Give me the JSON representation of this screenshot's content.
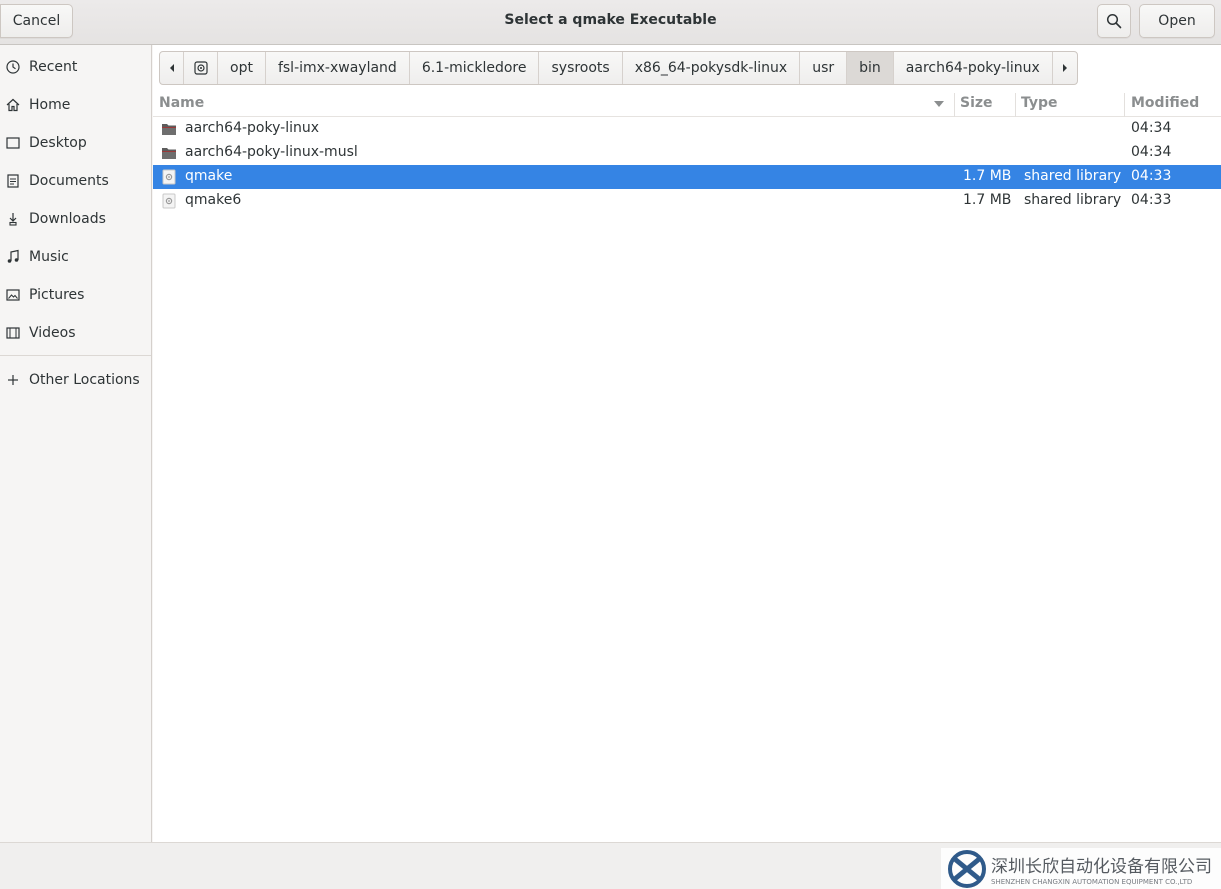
{
  "header": {
    "title": "Select a qmake Executable",
    "cancel_label": "Cancel",
    "open_label": "Open"
  },
  "sidebar": {
    "items": [
      {
        "label": "Recent",
        "icon": "clock-icon"
      },
      {
        "label": "Home",
        "icon": "home-icon"
      },
      {
        "label": "Desktop",
        "icon": "desktop-icon"
      },
      {
        "label": "Documents",
        "icon": "document-icon"
      },
      {
        "label": "Downloads",
        "icon": "download-icon"
      },
      {
        "label": "Music",
        "icon": "music-icon"
      },
      {
        "label": "Pictures",
        "icon": "picture-icon"
      },
      {
        "label": "Videos",
        "icon": "video-icon"
      }
    ],
    "other_locations": {
      "label": "Other Locations",
      "icon": "plus-icon"
    }
  },
  "pathbar": {
    "segments": [
      "opt",
      "fsl-imx-xwayland",
      "6.1-mickledore",
      "sysroots",
      "x86_64-pokysdk-linux",
      "usr",
      "bin",
      "aarch64-poky-linux"
    ],
    "active_segment": "bin"
  },
  "columns": {
    "name": "Name",
    "size": "Size",
    "type": "Type",
    "modified": "Modified"
  },
  "files": [
    {
      "name": "aarch64-poky-linux",
      "size": "",
      "type": "",
      "modified": "04:34",
      "kind": "folder"
    },
    {
      "name": "aarch64-poky-linux-musl",
      "size": "",
      "type": "",
      "modified": "04:34",
      "kind": "folder"
    },
    {
      "name": "qmake",
      "size": "1.7 MB",
      "type": "shared library",
      "modified": "04:33",
      "kind": "library",
      "selected": true
    },
    {
      "name": "qmake6",
      "size": "1.7 MB",
      "type": "shared library",
      "modified": "04:33",
      "kind": "library"
    }
  ],
  "watermark": {
    "cn": "深圳长欣自动化设备有限公司",
    "en": "SHENZHEN CHANGXIN AUTOMATION EQUIPMENT CO.,LTD"
  },
  "colors": {
    "selection": "#3584e4",
    "folder": "#5c5c5c"
  }
}
